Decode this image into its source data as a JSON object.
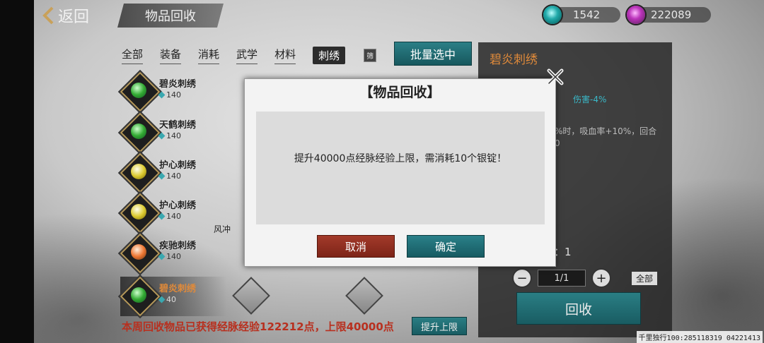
{
  "header": {
    "back_label": "返回",
    "title": "物品回收",
    "currency_a": "1542",
    "currency_b": "222089",
    "currency_a_icon": "teal-coin-icon",
    "currency_b_icon": "purple-coin-icon"
  },
  "tabs": [
    "全部",
    "装备",
    "消耗",
    "武学",
    "材料",
    "刺绣"
  ],
  "tab_badge": "筛",
  "batch_select": "批量选中",
  "items": [
    {
      "name": "碧炎刺绣",
      "price": "140",
      "orb": "green"
    },
    {
      "name": "天鹤刺绣",
      "price": "140",
      "orb": "green"
    },
    {
      "name": "护心刺绣",
      "price": "140",
      "orb": "yellow"
    },
    {
      "name": "护心刺绣",
      "price": "140",
      "orb": "yellow"
    },
    {
      "name": "疾驰刺绣",
      "price": "140",
      "orb": "orange"
    },
    {
      "name": "碧炎刺绣",
      "price": "40",
      "orb": "green"
    }
  ],
  "stray_label": "风冲",
  "detail": {
    "title": "碧炎刺绣",
    "stat_fragment": "伤害-4%",
    "desc_fragment": "%时，吸血率+10%，回合 0",
    "own_label": "有：1",
    "qty_value": "1/1",
    "all_label": "全部",
    "recycle_label": "回收"
  },
  "footer": {
    "notice": "本周回收物品已获得经脉经验122212点，上限40000点",
    "raise_label": "提升上限"
  },
  "modal": {
    "title": "【物品回收】",
    "message": "提升40000点经脉经验上限，需消耗10个银锭！",
    "cancel": "取消",
    "confirm": "确定"
  },
  "watermark": "千里独行100:285118319 04221413"
}
